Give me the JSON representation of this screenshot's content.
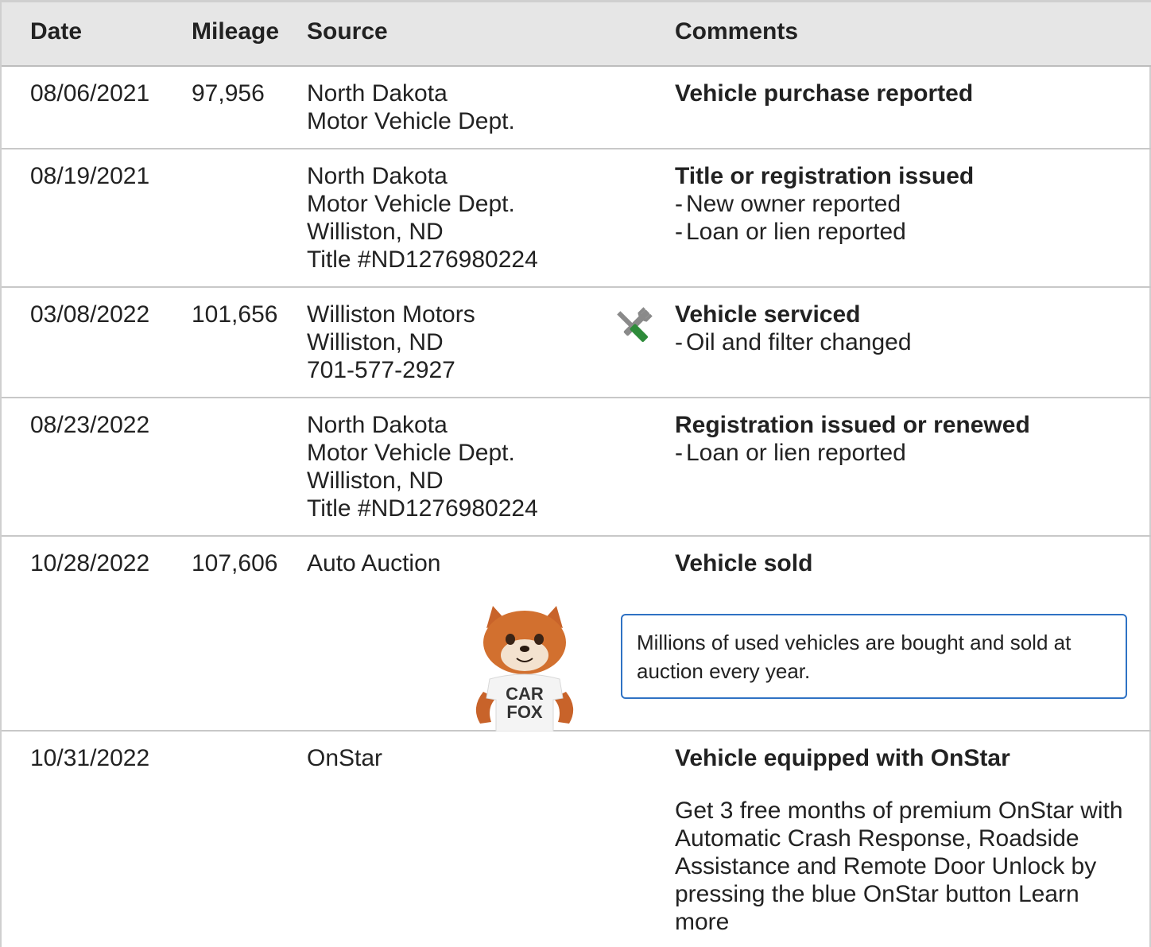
{
  "header": {
    "date": "Date",
    "mileage": "Mileage",
    "source": "Source",
    "comments": "Comments"
  },
  "rows": [
    {
      "date": "08/06/2021",
      "mileage": "97,956",
      "source": [
        "North Dakota",
        "Motor Vehicle Dept."
      ],
      "title": "Vehicle purchase reported",
      "details": []
    },
    {
      "date": "08/19/2021",
      "mileage": "",
      "source": [
        "North Dakota",
        "Motor Vehicle Dept.",
        "Williston, ND",
        "Title #ND1276980224"
      ],
      "title": "Title or registration issued",
      "details": [
        "New owner reported",
        "Loan or lien reported"
      ]
    },
    {
      "date": "03/08/2022",
      "mileage": "101,656",
      "source": [
        "Williston Motors",
        "Williston, ND",
        "701-577-2927"
      ],
      "title": "Vehicle serviced",
      "details": [
        "Oil and filter changed"
      ],
      "icon": "service-tools-icon"
    },
    {
      "date": "08/23/2022",
      "mileage": "",
      "source": [
        "North Dakota",
        "Motor Vehicle Dept.",
        "Williston, ND",
        "Title #ND1276980224"
      ],
      "title": "Registration issued or renewed",
      "details": [
        "Loan or lien reported"
      ]
    },
    {
      "date": "10/28/2022",
      "mileage": "107,606",
      "source": [
        "Auto Auction"
      ],
      "title": "Vehicle sold",
      "details": [],
      "callout": "Millions of used vehicles are bought and sold at auction every year.",
      "mascot_shirt": [
        "CAR",
        "FOX"
      ]
    },
    {
      "date": "10/31/2022",
      "mileage": "",
      "source": [
        "OnStar"
      ],
      "title": "Vehicle equipped with OnStar",
      "details": [],
      "paragraph": "Get 3 free months of premium OnStar with Automatic Crash Response, Roadside Assistance and Remote Door Unlock by pressing the blue OnStar button",
      "link": "Learn more"
    }
  ],
  "colors": {
    "header_bg": "#e6e6e6",
    "callout_border": "#2f72c4",
    "icon_green": "#2e8b3a",
    "icon_gray": "#8a8a8a"
  }
}
